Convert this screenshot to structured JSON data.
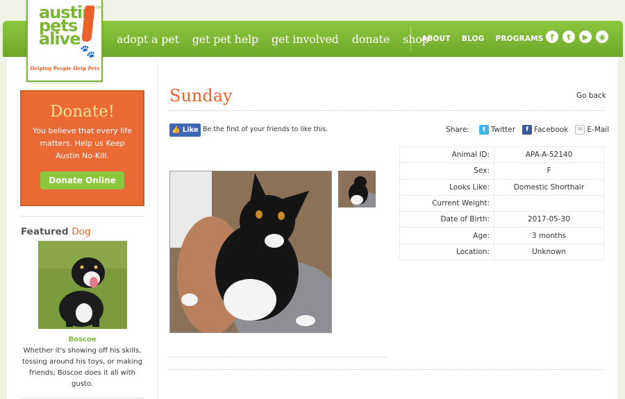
{
  "logo": {
    "line1": "austin",
    "line2": "pets",
    "line3": "alive",
    "tagline": "Helping People Help Pets",
    "tm": "TM"
  },
  "nav": {
    "main": [
      "adopt a pet",
      "get pet help",
      "get involved",
      "donate",
      "shop"
    ],
    "small": [
      "ABOUT",
      "BLOG",
      "PROGRAMS"
    ],
    "social": [
      {
        "icon": "facebook-icon",
        "glyph": "f"
      },
      {
        "icon": "twitter-icon",
        "glyph": "t"
      },
      {
        "icon": "youtube-icon",
        "glyph": "▶"
      },
      {
        "icon": "rss-icon",
        "glyph": "◉"
      }
    ]
  },
  "donate": {
    "title": "Donate!",
    "text": "You believe that every life matters. Help us Keep Austin No-Kill.",
    "button": "Donate Online"
  },
  "featured": {
    "label": "Featured",
    "type": "Dog",
    "name": "Boscoe",
    "description": "Whether it's showing off his skills, tossing around his toys, or making friends, Boscoe does it all with gusto."
  },
  "pet": {
    "name": "Sunday",
    "go_back": "Go back",
    "like": {
      "button": "Like",
      "text": "Be the first of your friends to like this."
    },
    "share": {
      "label": "Share:",
      "twitter": "Twitter",
      "facebook": "Facebook",
      "email": "E-Mail"
    },
    "details": [
      {
        "label": "Animal ID:",
        "value": "APA-A-52140"
      },
      {
        "label": "Sex:",
        "value": "F"
      },
      {
        "label": "Looks Like:",
        "value": "Domestic Shorthair"
      },
      {
        "label": "Current Weight:",
        "value": ""
      },
      {
        "label": "Date of Birth:",
        "value": "2017-05-30"
      },
      {
        "label": "Age:",
        "value": "3 months"
      },
      {
        "label": "Location:",
        "value": "Unknown"
      }
    ]
  },
  "colors": {
    "green": "#7db535",
    "orange": "#e8622a",
    "facebook_blue": "#4267b2",
    "twitter_blue": "#3fb5e8"
  }
}
